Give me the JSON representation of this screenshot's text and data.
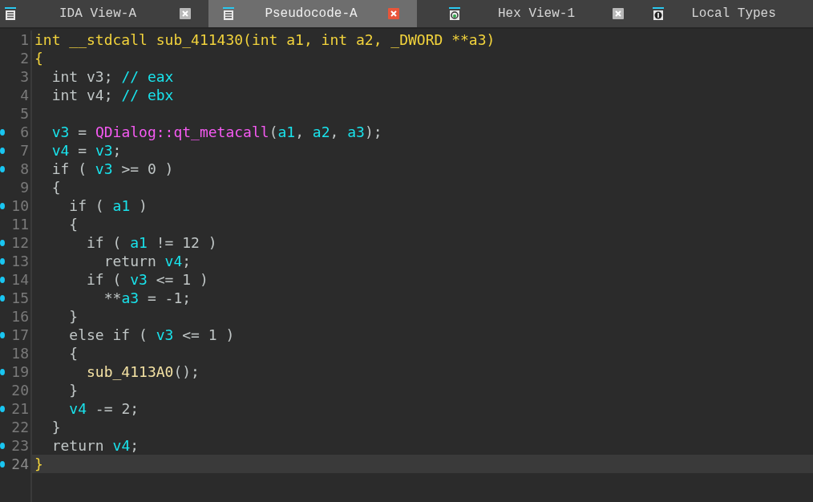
{
  "tabs": [
    {
      "label": "IDA View-A",
      "kind": "listing",
      "selected": false,
      "closable": true
    },
    {
      "label": "Pseudocode-A",
      "kind": "listing",
      "selected": true,
      "closable": true
    },
    {
      "label": "Hex View-1",
      "kind": "hex",
      "selected": false,
      "closable": true
    },
    {
      "label": "Local Types",
      "kind": "types",
      "selected": false,
      "closable": false
    }
  ],
  "code": {
    "lines": [
      {
        "number": "1",
        "dot": false,
        "current": false,
        "tokens": [
          {
            "kind": "header",
            "text": "int __stdcall sub_411430(int a1, int a2, _DWORD **a3)"
          }
        ]
      },
      {
        "number": "2",
        "dot": false,
        "current": false,
        "tokens": [
          {
            "kind": "header",
            "text": "{"
          }
        ]
      },
      {
        "number": "3",
        "dot": false,
        "current": false,
        "tokens": [
          {
            "kind": "plain",
            "text": "  int v3; "
          },
          {
            "kind": "var",
            "text": "// eax"
          }
        ]
      },
      {
        "number": "4",
        "dot": false,
        "current": false,
        "tokens": [
          {
            "kind": "plain",
            "text": "  int v4; "
          },
          {
            "kind": "var",
            "text": "// ebx"
          }
        ]
      },
      {
        "number": "5",
        "dot": false,
        "current": false
      },
      {
        "number": "6",
        "dot": true,
        "current": false,
        "tokens": [
          {
            "kind": "var",
            "text": "  v3"
          },
          {
            "kind": "plain",
            "text": " = "
          },
          {
            "kind": "import",
            "text": "QDialog::qt_metacall"
          },
          {
            "kind": "plain",
            "text": "("
          },
          {
            "kind": "var",
            "text": "a1"
          },
          {
            "kind": "plain",
            "text": ", "
          },
          {
            "kind": "var",
            "text": "a2"
          },
          {
            "kind": "plain",
            "text": ", "
          },
          {
            "kind": "var",
            "text": "a3"
          },
          {
            "kind": "plain",
            "text": ");"
          }
        ]
      },
      {
        "number": "7",
        "dot": true,
        "current": false,
        "tokens": [
          {
            "kind": "var",
            "text": "  v4"
          },
          {
            "kind": "plain",
            "text": " = "
          },
          {
            "kind": "var",
            "text": "v3"
          },
          {
            "kind": "plain",
            "text": ";"
          }
        ]
      },
      {
        "number": "8",
        "dot": true,
        "current": false,
        "tokens": [
          {
            "kind": "plain",
            "text": "  if ( "
          },
          {
            "kind": "var",
            "text": "v3"
          },
          {
            "kind": "plain",
            "text": " >= 0 )"
          }
        ]
      },
      {
        "number": "9",
        "dot": false,
        "current": false,
        "tokens": [
          {
            "kind": "plain",
            "text": "  {"
          }
        ]
      },
      {
        "number": "10",
        "dot": true,
        "current": false,
        "tokens": [
          {
            "kind": "plain",
            "text": "    if ( "
          },
          {
            "kind": "var",
            "text": "a1"
          },
          {
            "kind": "plain",
            "text": " )"
          }
        ]
      },
      {
        "number": "11",
        "dot": false,
        "current": false,
        "tokens": [
          {
            "kind": "plain",
            "text": "    {"
          }
        ]
      },
      {
        "number": "12",
        "dot": true,
        "current": false,
        "tokens": [
          {
            "kind": "plain",
            "text": "      if ( "
          },
          {
            "kind": "var",
            "text": "a1"
          },
          {
            "kind": "plain",
            "text": " != 12 )"
          }
        ]
      },
      {
        "number": "13",
        "dot": true,
        "current": false,
        "tokens": [
          {
            "kind": "plain",
            "text": "        return "
          },
          {
            "kind": "var",
            "text": "v4"
          },
          {
            "kind": "plain",
            "text": ";"
          }
        ]
      },
      {
        "number": "14",
        "dot": true,
        "current": false,
        "tokens": [
          {
            "kind": "plain",
            "text": "      if ( "
          },
          {
            "kind": "var",
            "text": "v3"
          },
          {
            "kind": "plain",
            "text": " <= 1 )"
          }
        ]
      },
      {
        "number": "15",
        "dot": true,
        "current": false,
        "tokens": [
          {
            "kind": "plain",
            "text": "        **"
          },
          {
            "kind": "var",
            "text": "a3"
          },
          {
            "kind": "plain",
            "text": " = -1;"
          }
        ]
      },
      {
        "number": "16",
        "dot": false,
        "current": false,
        "tokens": [
          {
            "kind": "plain",
            "text": "    }"
          }
        ]
      },
      {
        "number": "17",
        "dot": true,
        "current": false,
        "tokens": [
          {
            "kind": "plain",
            "text": "    else if ( "
          },
          {
            "kind": "var",
            "text": "v3"
          },
          {
            "kind": "plain",
            "text": " <= 1 )"
          }
        ]
      },
      {
        "number": "18",
        "dot": false,
        "current": false,
        "tokens": [
          {
            "kind": "plain",
            "text": "    {"
          }
        ]
      },
      {
        "number": "19",
        "dot": true,
        "current": false,
        "tokens": [
          {
            "kind": "call",
            "text": "      sub_4113A0"
          },
          {
            "kind": "plain",
            "text": "();"
          }
        ]
      },
      {
        "number": "20",
        "dot": false,
        "current": false,
        "tokens": [
          {
            "kind": "plain",
            "text": "    }"
          }
        ]
      },
      {
        "number": "21",
        "dot": true,
        "current": false,
        "tokens": [
          {
            "kind": "var",
            "text": "    v4"
          },
          {
            "kind": "plain",
            "text": " -= 2;"
          }
        ]
      },
      {
        "number": "22",
        "dot": false,
        "current": false,
        "tokens": [
          {
            "kind": "plain",
            "text": "  }"
          }
        ]
      },
      {
        "number": "23",
        "dot": true,
        "current": false,
        "tokens": [
          {
            "kind": "plain",
            "text": "  return "
          },
          {
            "kind": "var",
            "text": "v4"
          },
          {
            "kind": "plain",
            "text": ";"
          }
        ]
      },
      {
        "number": "24",
        "dot": true,
        "current": true,
        "tokens": [
          {
            "kind": "header",
            "text": "}"
          }
        ]
      }
    ]
  }
}
